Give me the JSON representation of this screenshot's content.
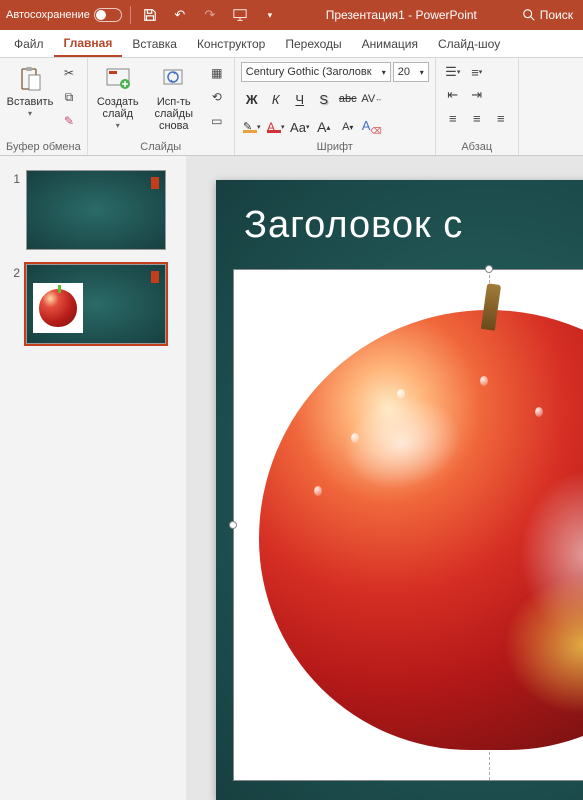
{
  "titlebar": {
    "autosave_label": "Автосохранение",
    "doc_title": "Презентация1 - PowerPoint",
    "search_label": "Поиск"
  },
  "tabs": {
    "file": "Файл",
    "home": "Главная",
    "insert": "Вставка",
    "design": "Конструктор",
    "transitions": "Переходы",
    "animations": "Анимация",
    "slideshow": "Слайд-шоу"
  },
  "ribbon": {
    "clipboard": {
      "paste": "Вставить",
      "label": "Буфер обмена"
    },
    "slides": {
      "new_slide": "Создать слайд",
      "reuse": "Исп-ть слайды снова",
      "label": "Слайды"
    },
    "font": {
      "name_value": "Century Gothic (Заголовк",
      "size_value": "20",
      "bold": "Ж",
      "italic": "К",
      "underline": "Ч",
      "strike": "S",
      "abc": "abc",
      "spacing": "AV",
      "aa": "Aa",
      "grow": "A",
      "shrink": "A",
      "clear": "A",
      "label": "Шрифт"
    },
    "paragraph": {
      "label": "Абзац"
    }
  },
  "thumbs": {
    "n1": "1",
    "n2": "2"
  },
  "slide": {
    "title": "Заголовок с"
  }
}
